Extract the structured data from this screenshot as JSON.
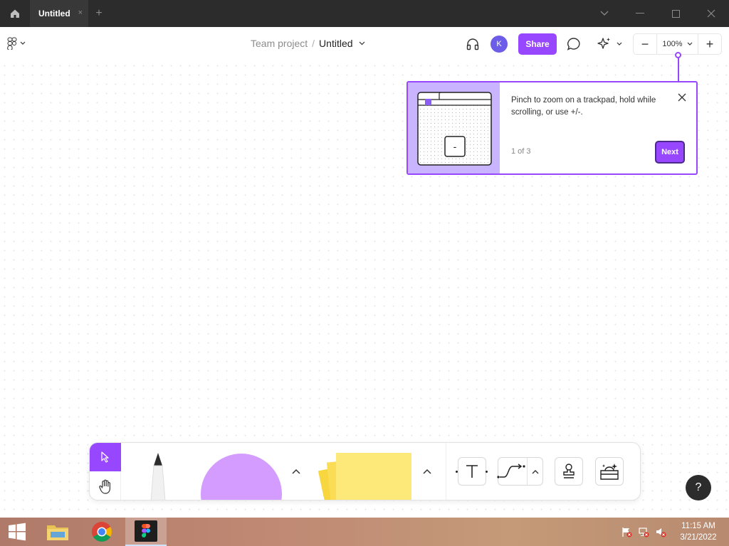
{
  "titlebar": {
    "tab_label": "Untitled",
    "tab_close": "×",
    "new_tab": "+"
  },
  "toolbar": {
    "breadcrumb_team": "Team project",
    "breadcrumb_separator": "/",
    "breadcrumb_file": "Untitled",
    "avatar_initial": "K",
    "share_label": "Share",
    "zoom_value": "100%",
    "zoom_minus": "−",
    "zoom_plus": "+"
  },
  "onboarding": {
    "message": "Pinch to zoom on a trackpad, hold while scrolling, or use +/-.",
    "step": "1 of 3",
    "next_label": "Next",
    "illustration_key": "-"
  },
  "bottom_toolbar": {
    "tools": [
      "move",
      "hand",
      "marker",
      "shape",
      "sticky-note",
      "text",
      "connector",
      "stamp",
      "widgets"
    ],
    "active_tool": "move"
  },
  "help_label": "?",
  "taskbar": {
    "apps": [
      "File Explorer",
      "Google Chrome",
      "Figma"
    ],
    "active_app": "Figma",
    "time": "11:15 AM",
    "date": "3/21/2022"
  },
  "colors": {
    "accent": "#9747ff",
    "titlebar": "#2c2c2c",
    "popover_illustration": "#c9b4ff",
    "shape_tool": "#d59cff",
    "sticky": "#fde87a"
  }
}
